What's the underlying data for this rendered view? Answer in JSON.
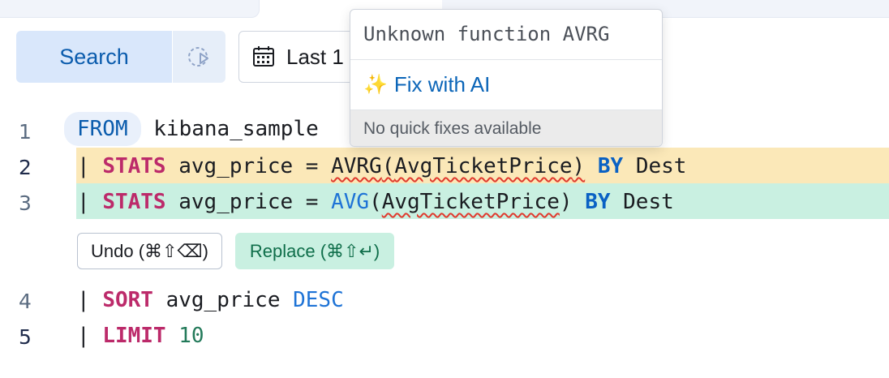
{
  "toolbar": {
    "search_label": "Search",
    "date_label": "Last 1"
  },
  "popover": {
    "error_message": "Unknown function AVRG",
    "fix_icon": "✨",
    "fix_label": "Fix with AI",
    "no_fixes_label": "No quick fixes available"
  },
  "editor": {
    "lines": [
      {
        "num": "1",
        "from_kw": "FROM",
        "rest": " kibana_sample"
      },
      {
        "num": "2",
        "pipe": "| ",
        "kw": "STATS",
        "pre": " avg_price = ",
        "fn": "AVRG",
        "paren_open": "(",
        "arg": "AvgTicketPrice",
        "paren_close": ")",
        "by": "BY",
        "field": "Dest"
      },
      {
        "num": "3",
        "pipe": "| ",
        "kw": "STATS",
        "pre": " avg_price = ",
        "fn": "AVG",
        "paren_open": "(",
        "arg": "AvgTicketPrice",
        "paren_close": ")",
        "by": "BY",
        "field": "Dest"
      },
      {
        "num": "4",
        "pipe": "| ",
        "kw": "SORT",
        "rest": " avg_price ",
        "order": "DESC"
      },
      {
        "num": "5",
        "pipe": "| ",
        "kw": "LIMIT",
        "value": "10"
      }
    ],
    "undo_label": "Undo (⌘⇧⌫)",
    "replace_label": "Replace (⌘⇧↵)"
  },
  "colors": {
    "removed_line": "#fbe8b8",
    "added_line": "#c9f0e1",
    "keyword": "#bc2a6a",
    "by_keyword": "#0a61c4",
    "error_underline": "#e03a2e"
  }
}
